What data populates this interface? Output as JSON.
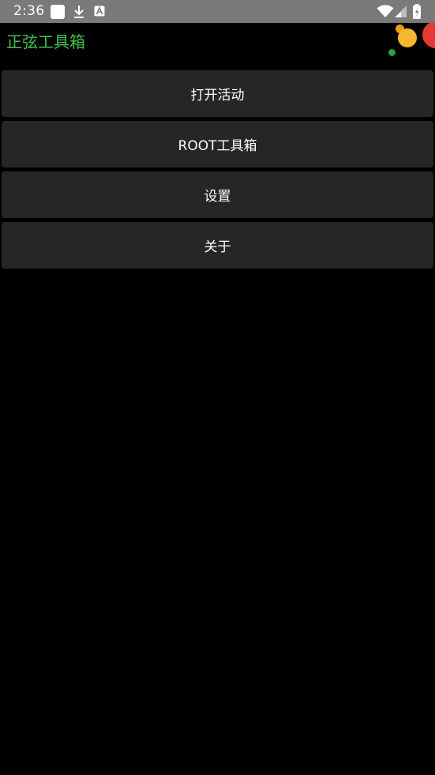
{
  "status_bar": {
    "time": "2:36",
    "icons": [
      "notification-square-icon",
      "download-icon",
      "a-icon",
      "wifi-icon",
      "signal-icon",
      "battery-icon"
    ]
  },
  "app_bar": {
    "title": "正弦工具箱",
    "title_color": "#3fc24d"
  },
  "menu": {
    "items": [
      {
        "label": "打开活动"
      },
      {
        "label": "ROOT工具箱"
      },
      {
        "label": "设置"
      },
      {
        "label": "关于"
      }
    ]
  },
  "colors": {
    "background": "#000000",
    "button": "#262626",
    "status_bar": "#7a7a7a",
    "accent_orange": "#f5a623",
    "accent_red": "#e53935",
    "accent_green": "#2e9e3a"
  }
}
